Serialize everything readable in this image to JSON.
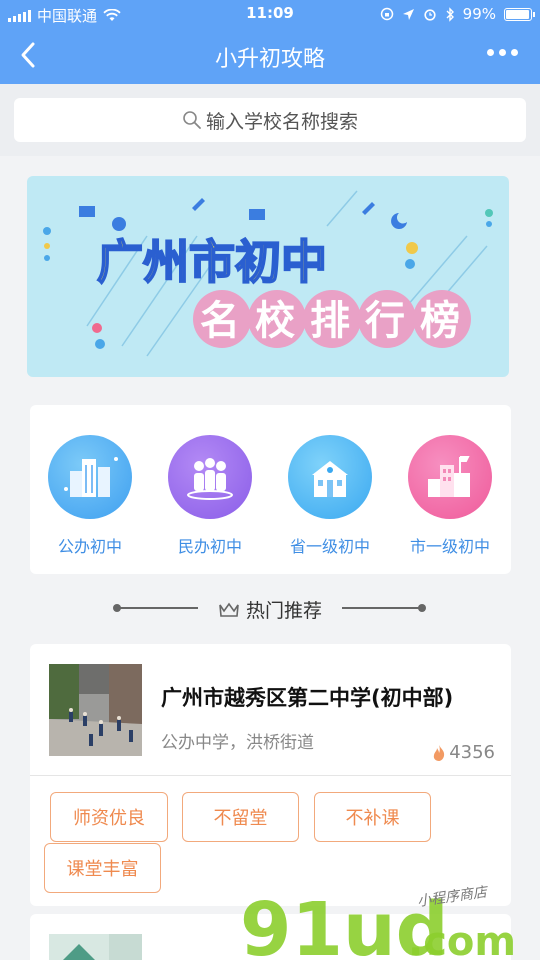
{
  "status_bar": {
    "carrier": "中国联通",
    "time": "11:09",
    "battery": "99%",
    "battery_level": 0.99
  },
  "nav": {
    "title": "小升初攻略",
    "back_icon": "chevron-left-icon",
    "more_icon": "more-dots-icon"
  },
  "search": {
    "placeholder": "输入学校名称搜索",
    "icon": "search-icon"
  },
  "banner": {
    "line1": "广州市初中",
    "line2": "名校排行榜"
  },
  "categories": [
    {
      "label": "公办初中",
      "icon": "buildings-icon",
      "color": "#52b0f3"
    },
    {
      "label": "民办初中",
      "icon": "people-icon",
      "color": "#9a6bed"
    },
    {
      "label": "省一级初中",
      "icon": "school-icon",
      "color": "#4db8f2"
    },
    {
      "label": "市一级初中",
      "icon": "city-icon",
      "color": "#f26aa6"
    }
  ],
  "hot_section": {
    "title": "热门推荐",
    "icon": "crown-icon"
  },
  "schools": [
    {
      "name": "广州市越秀区第二中学(初中部)",
      "subtitle": "公办中学，洪桥街道",
      "views": "4356",
      "tags": [
        "师资优良",
        "不留堂",
        "不补课",
        "课堂丰富"
      ]
    }
  ],
  "watermark": {
    "logo": "91ud",
    "domain": ".com",
    "caption": "小程序商店"
  },
  "colors": {
    "nav_bg": "#5fa3f7",
    "accent_blue": "#3f8ee4",
    "tag_orange": "#ef8a4f"
  }
}
